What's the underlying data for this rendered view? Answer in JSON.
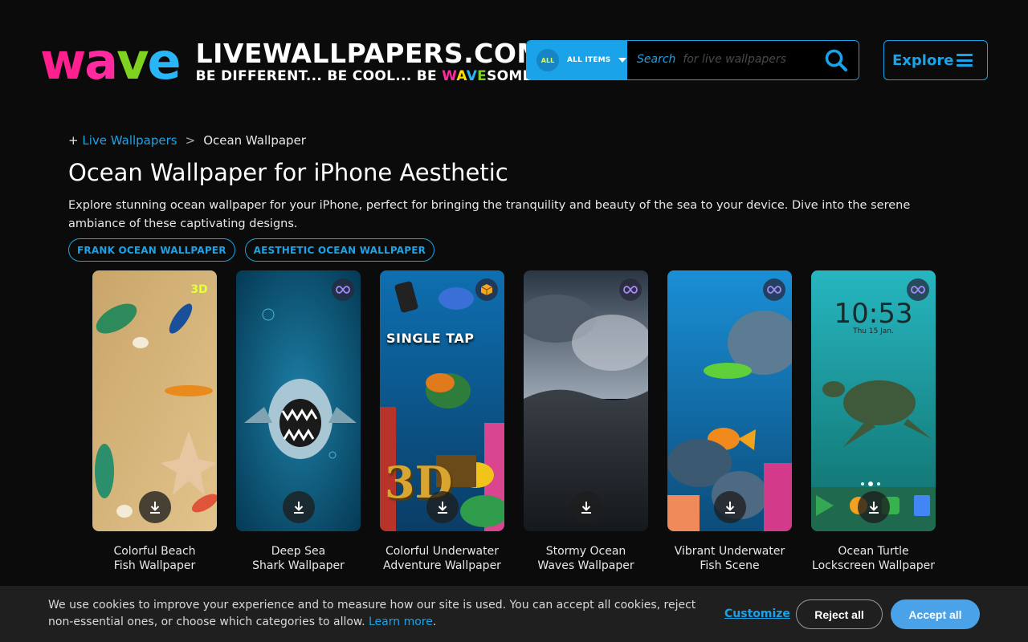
{
  "header": {
    "logo_wave_letters": [
      "w",
      "a",
      "v",
      "e"
    ],
    "logo_wave_colors": [
      "#ff1f8f",
      "#ff2aa0",
      "#7ed321",
      "#29b6f6"
    ],
    "logo_title": "LIVEWALLPAPERS.COM",
    "logo_tag_parts": [
      "BE DIFFERENT... BE COOL... BE ",
      "W",
      "A",
      "V",
      "E",
      "SOME!"
    ],
    "search": {
      "category_badge": "ALL",
      "category_label": "ALL ITEMS",
      "placeholder_a": "Search",
      "placeholder_b": "for live wallpapers"
    },
    "explore_label": "Explore"
  },
  "breadcrumb": {
    "prefix": "+",
    "parent": "Live Wallpapers",
    "separator": ">",
    "current": "Ocean Wallpaper"
  },
  "page_title": "Ocean Wallpaper for iPhone Aesthetic",
  "description": "Explore stunning ocean wallpaper for your iPhone, perfect for bringing the tranquility and beauty of the sea to your device. Dive into the serene ambiance of these captivating designs.",
  "tags": [
    "FRANK OCEAN WALLPAPER",
    "AESTHETIC OCEAN WALLPAPER"
  ],
  "cards": [
    {
      "title_l1": "Colorful Beach",
      "title_l2": "Fish Wallpaper",
      "badge": "3D",
      "badge_icon": "3d-icon"
    },
    {
      "title_l1": "Deep Sea",
      "title_l2": "Shark Wallpaper",
      "badge": "",
      "badge_icon": "infinity-icon"
    },
    {
      "title_l1": "Colorful Underwater",
      "title_l2": "Adventure Wallpaper",
      "badge": "",
      "badge_icon": "cube-icon",
      "overlay_text": "SINGLE TAP",
      "overlay_text2": "3D"
    },
    {
      "title_l1": "Stormy Ocean",
      "title_l2": "Waves Wallpaper",
      "badge": "",
      "badge_icon": "infinity-icon"
    },
    {
      "title_l1": "Vibrant Underwater",
      "title_l2": "Fish Scene",
      "badge": "",
      "badge_icon": "infinity-icon"
    },
    {
      "title_l1": "Ocean Turtle",
      "title_l2": "Lockscreen Wallpaper",
      "badge": "",
      "badge_icon": "infinity-icon",
      "clock": "10:53",
      "date": "Thu 15 Jan."
    }
  ],
  "cookie": {
    "text": "We use cookies to improve your experience and to measure how our site is used. You can accept all cookies, reject non-essential ones, or choose which categories to allow.",
    "learn_more": "Learn more",
    "customize": "Customize",
    "reject": "Reject all",
    "accept": "Accept all"
  },
  "colors": {
    "accent": "#1aa3e8",
    "background": "#0b0b0b",
    "cookie_bar": "#1f1f1f"
  }
}
